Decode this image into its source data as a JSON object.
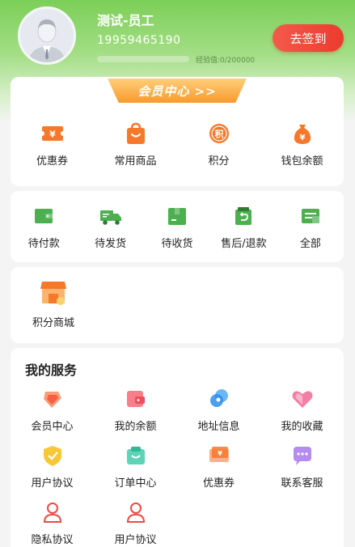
{
  "user": {
    "name": "测试-员工",
    "phone": "19959465190",
    "exp_text": "经验值:0/200000",
    "exp_progress": 0.0,
    "checkin_label": "去签到"
  },
  "member_center": {
    "banner": "会员中心 >>",
    "items": [
      {
        "label": "优惠券",
        "icon": "coupon-icon"
      },
      {
        "label": "常用商品",
        "icon": "shopping-bag-icon"
      },
      {
        "label": "积分",
        "icon": "points-icon"
      },
      {
        "label": "钱包余额",
        "icon": "wallet-balance-icon"
      }
    ]
  },
  "orders": {
    "items": [
      {
        "label": "待付款",
        "icon": "wallet-icon"
      },
      {
        "label": "待发货",
        "icon": "truck-icon"
      },
      {
        "label": "待收货",
        "icon": "package-icon"
      },
      {
        "label": "售后/退款",
        "icon": "refund-icon"
      },
      {
        "label": "全部",
        "icon": "list-icon"
      }
    ]
  },
  "mall": {
    "label": "积分商城",
    "icon": "store-icon"
  },
  "services": {
    "title": "我的服务",
    "items": [
      {
        "label": "会员中心",
        "icon": "vip-icon"
      },
      {
        "label": "我的余额",
        "icon": "balance-icon"
      },
      {
        "label": "地址信息",
        "icon": "location-icon"
      },
      {
        "label": "我的收藏",
        "icon": "heart-icon"
      },
      {
        "label": "用户协议",
        "icon": "shield-icon"
      },
      {
        "label": "订单中心",
        "icon": "order-icon"
      },
      {
        "label": "优惠券",
        "icon": "ticket-icon"
      },
      {
        "label": "联系客服",
        "icon": "chat-icon"
      },
      {
        "label": "隐私协议",
        "icon": "user-icon"
      },
      {
        "label": "用户协议",
        "icon": "user-icon"
      }
    ]
  },
  "colors": {
    "green": "#7ccf58",
    "orange": "#f6792b",
    "red": "#ec3b2f"
  }
}
